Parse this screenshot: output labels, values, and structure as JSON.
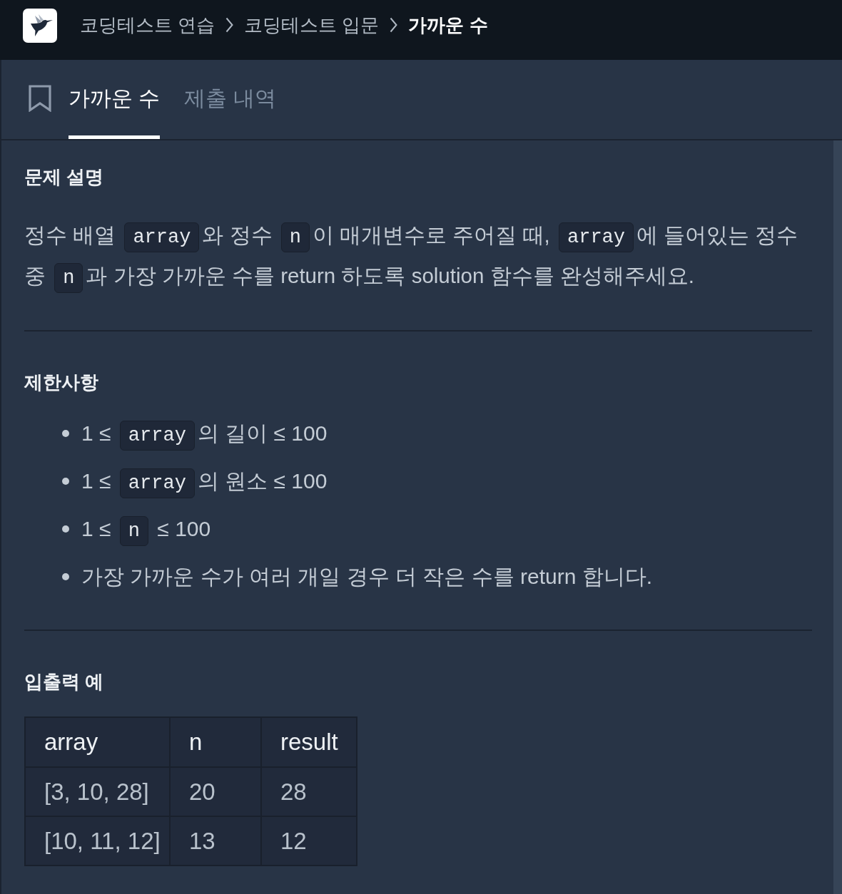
{
  "header": {
    "breadcrumbs": [
      {
        "label": "코딩테스트 연습",
        "current": false
      },
      {
        "label": "코딩테스트 입문",
        "current": false
      },
      {
        "label": "가까운 수",
        "current": true
      }
    ]
  },
  "tabs": [
    {
      "label": "가까운 수",
      "selected": true
    },
    {
      "label": "제출 내역",
      "selected": false
    }
  ],
  "sections": [
    {
      "kind": "paragraph",
      "title": "문제 설명",
      "segments": [
        {
          "kind": "text",
          "text": "정수 배열 "
        },
        {
          "kind": "code",
          "text": "array"
        },
        {
          "kind": "text",
          "text": "와 정수 "
        },
        {
          "kind": "code",
          "text": "n"
        },
        {
          "kind": "text",
          "text": "이 매개변수로 주어질 때, "
        },
        {
          "kind": "code",
          "text": "array"
        },
        {
          "kind": "text",
          "text": "에 들어있는 정수 중 "
        },
        {
          "kind": "code",
          "text": "n"
        },
        {
          "kind": "text",
          "text": "과 가장 가까운 수를 return 하도록 solution 함수를 완성해주세요."
        }
      ]
    },
    {
      "kind": "list",
      "title": "제한사항",
      "items": [
        {
          "segments": [
            {
              "kind": "text",
              "text": "1 ≤ "
            },
            {
              "kind": "code",
              "text": "array"
            },
            {
              "kind": "text",
              "text": "의 길이 ≤ 100"
            }
          ]
        },
        {
          "segments": [
            {
              "kind": "text",
              "text": "1 ≤ "
            },
            {
              "kind": "code",
              "text": "array"
            },
            {
              "kind": "text",
              "text": "의 원소 ≤ 100"
            }
          ]
        },
        {
          "segments": [
            {
              "kind": "text",
              "text": "1 ≤ "
            },
            {
              "kind": "code",
              "text": "n"
            },
            {
              "kind": "text",
              "text": " ≤ 100"
            }
          ]
        },
        {
          "segments": [
            {
              "kind": "text",
              "text": "가장 가까운 수가 여러 개일 경우 더 작은 수를 return 합니다."
            }
          ]
        }
      ]
    },
    {
      "kind": "table",
      "title": "입출력 예",
      "columns": [
        "array",
        "n",
        "result"
      ],
      "rows": [
        [
          "[3, 10, 28]",
          "20",
          "28"
        ],
        [
          "[10, 11, 12]",
          "13",
          "12"
        ]
      ]
    }
  ]
}
